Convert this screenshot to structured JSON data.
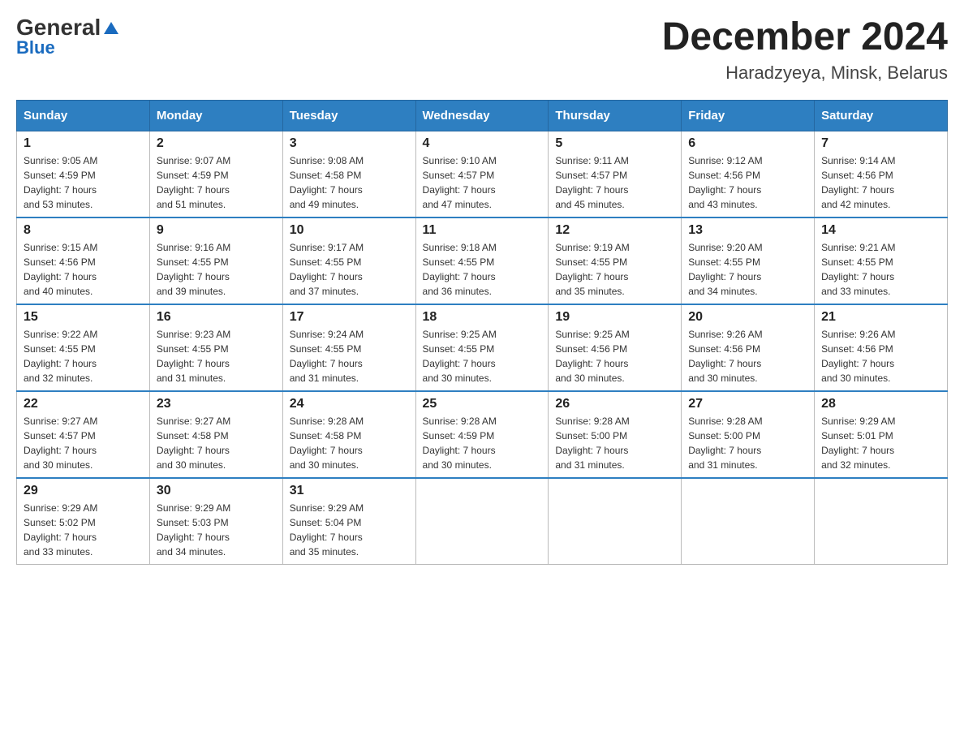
{
  "logo": {
    "general": "General",
    "blue": "Blue",
    "arrow": "▶"
  },
  "title": "December 2024",
  "location": "Haradzyeya, Minsk, Belarus",
  "days_of_week": [
    "Sunday",
    "Monday",
    "Tuesday",
    "Wednesday",
    "Thursday",
    "Friday",
    "Saturday"
  ],
  "weeks": [
    [
      {
        "day": "1",
        "sunrise": "9:05 AM",
        "sunset": "4:59 PM",
        "daylight": "7 hours and 53 minutes."
      },
      {
        "day": "2",
        "sunrise": "9:07 AM",
        "sunset": "4:59 PM",
        "daylight": "7 hours and 51 minutes."
      },
      {
        "day": "3",
        "sunrise": "9:08 AM",
        "sunset": "4:58 PM",
        "daylight": "7 hours and 49 minutes."
      },
      {
        "day": "4",
        "sunrise": "9:10 AM",
        "sunset": "4:57 PM",
        "daylight": "7 hours and 47 minutes."
      },
      {
        "day": "5",
        "sunrise": "9:11 AM",
        "sunset": "4:57 PM",
        "daylight": "7 hours and 45 minutes."
      },
      {
        "day": "6",
        "sunrise": "9:12 AM",
        "sunset": "4:56 PM",
        "daylight": "7 hours and 43 minutes."
      },
      {
        "day": "7",
        "sunrise": "9:14 AM",
        "sunset": "4:56 PM",
        "daylight": "7 hours and 42 minutes."
      }
    ],
    [
      {
        "day": "8",
        "sunrise": "9:15 AM",
        "sunset": "4:56 PM",
        "daylight": "7 hours and 40 minutes."
      },
      {
        "day": "9",
        "sunrise": "9:16 AM",
        "sunset": "4:55 PM",
        "daylight": "7 hours and 39 minutes."
      },
      {
        "day": "10",
        "sunrise": "9:17 AM",
        "sunset": "4:55 PM",
        "daylight": "7 hours and 37 minutes."
      },
      {
        "day": "11",
        "sunrise": "9:18 AM",
        "sunset": "4:55 PM",
        "daylight": "7 hours and 36 minutes."
      },
      {
        "day": "12",
        "sunrise": "9:19 AM",
        "sunset": "4:55 PM",
        "daylight": "7 hours and 35 minutes."
      },
      {
        "day": "13",
        "sunrise": "9:20 AM",
        "sunset": "4:55 PM",
        "daylight": "7 hours and 34 minutes."
      },
      {
        "day": "14",
        "sunrise": "9:21 AM",
        "sunset": "4:55 PM",
        "daylight": "7 hours and 33 minutes."
      }
    ],
    [
      {
        "day": "15",
        "sunrise": "9:22 AM",
        "sunset": "4:55 PM",
        "daylight": "7 hours and 32 minutes."
      },
      {
        "day": "16",
        "sunrise": "9:23 AM",
        "sunset": "4:55 PM",
        "daylight": "7 hours and 31 minutes."
      },
      {
        "day": "17",
        "sunrise": "9:24 AM",
        "sunset": "4:55 PM",
        "daylight": "7 hours and 31 minutes."
      },
      {
        "day": "18",
        "sunrise": "9:25 AM",
        "sunset": "4:55 PM",
        "daylight": "7 hours and 30 minutes."
      },
      {
        "day": "19",
        "sunrise": "9:25 AM",
        "sunset": "4:56 PM",
        "daylight": "7 hours and 30 minutes."
      },
      {
        "day": "20",
        "sunrise": "9:26 AM",
        "sunset": "4:56 PM",
        "daylight": "7 hours and 30 minutes."
      },
      {
        "day": "21",
        "sunrise": "9:26 AM",
        "sunset": "4:56 PM",
        "daylight": "7 hours and 30 minutes."
      }
    ],
    [
      {
        "day": "22",
        "sunrise": "9:27 AM",
        "sunset": "4:57 PM",
        "daylight": "7 hours and 30 minutes."
      },
      {
        "day": "23",
        "sunrise": "9:27 AM",
        "sunset": "4:58 PM",
        "daylight": "7 hours and 30 minutes."
      },
      {
        "day": "24",
        "sunrise": "9:28 AM",
        "sunset": "4:58 PM",
        "daylight": "7 hours and 30 minutes."
      },
      {
        "day": "25",
        "sunrise": "9:28 AM",
        "sunset": "4:59 PM",
        "daylight": "7 hours and 30 minutes."
      },
      {
        "day": "26",
        "sunrise": "9:28 AM",
        "sunset": "5:00 PM",
        "daylight": "7 hours and 31 minutes."
      },
      {
        "day": "27",
        "sunrise": "9:28 AM",
        "sunset": "5:00 PM",
        "daylight": "7 hours and 31 minutes."
      },
      {
        "day": "28",
        "sunrise": "9:29 AM",
        "sunset": "5:01 PM",
        "daylight": "7 hours and 32 minutes."
      }
    ],
    [
      {
        "day": "29",
        "sunrise": "9:29 AM",
        "sunset": "5:02 PM",
        "daylight": "7 hours and 33 minutes."
      },
      {
        "day": "30",
        "sunrise": "9:29 AM",
        "sunset": "5:03 PM",
        "daylight": "7 hours and 34 minutes."
      },
      {
        "day": "31",
        "sunrise": "9:29 AM",
        "sunset": "5:04 PM",
        "daylight": "7 hours and 35 minutes."
      },
      null,
      null,
      null,
      null
    ]
  ],
  "labels": {
    "sunrise": "Sunrise: ",
    "sunset": "Sunset: ",
    "daylight": "Daylight: "
  }
}
